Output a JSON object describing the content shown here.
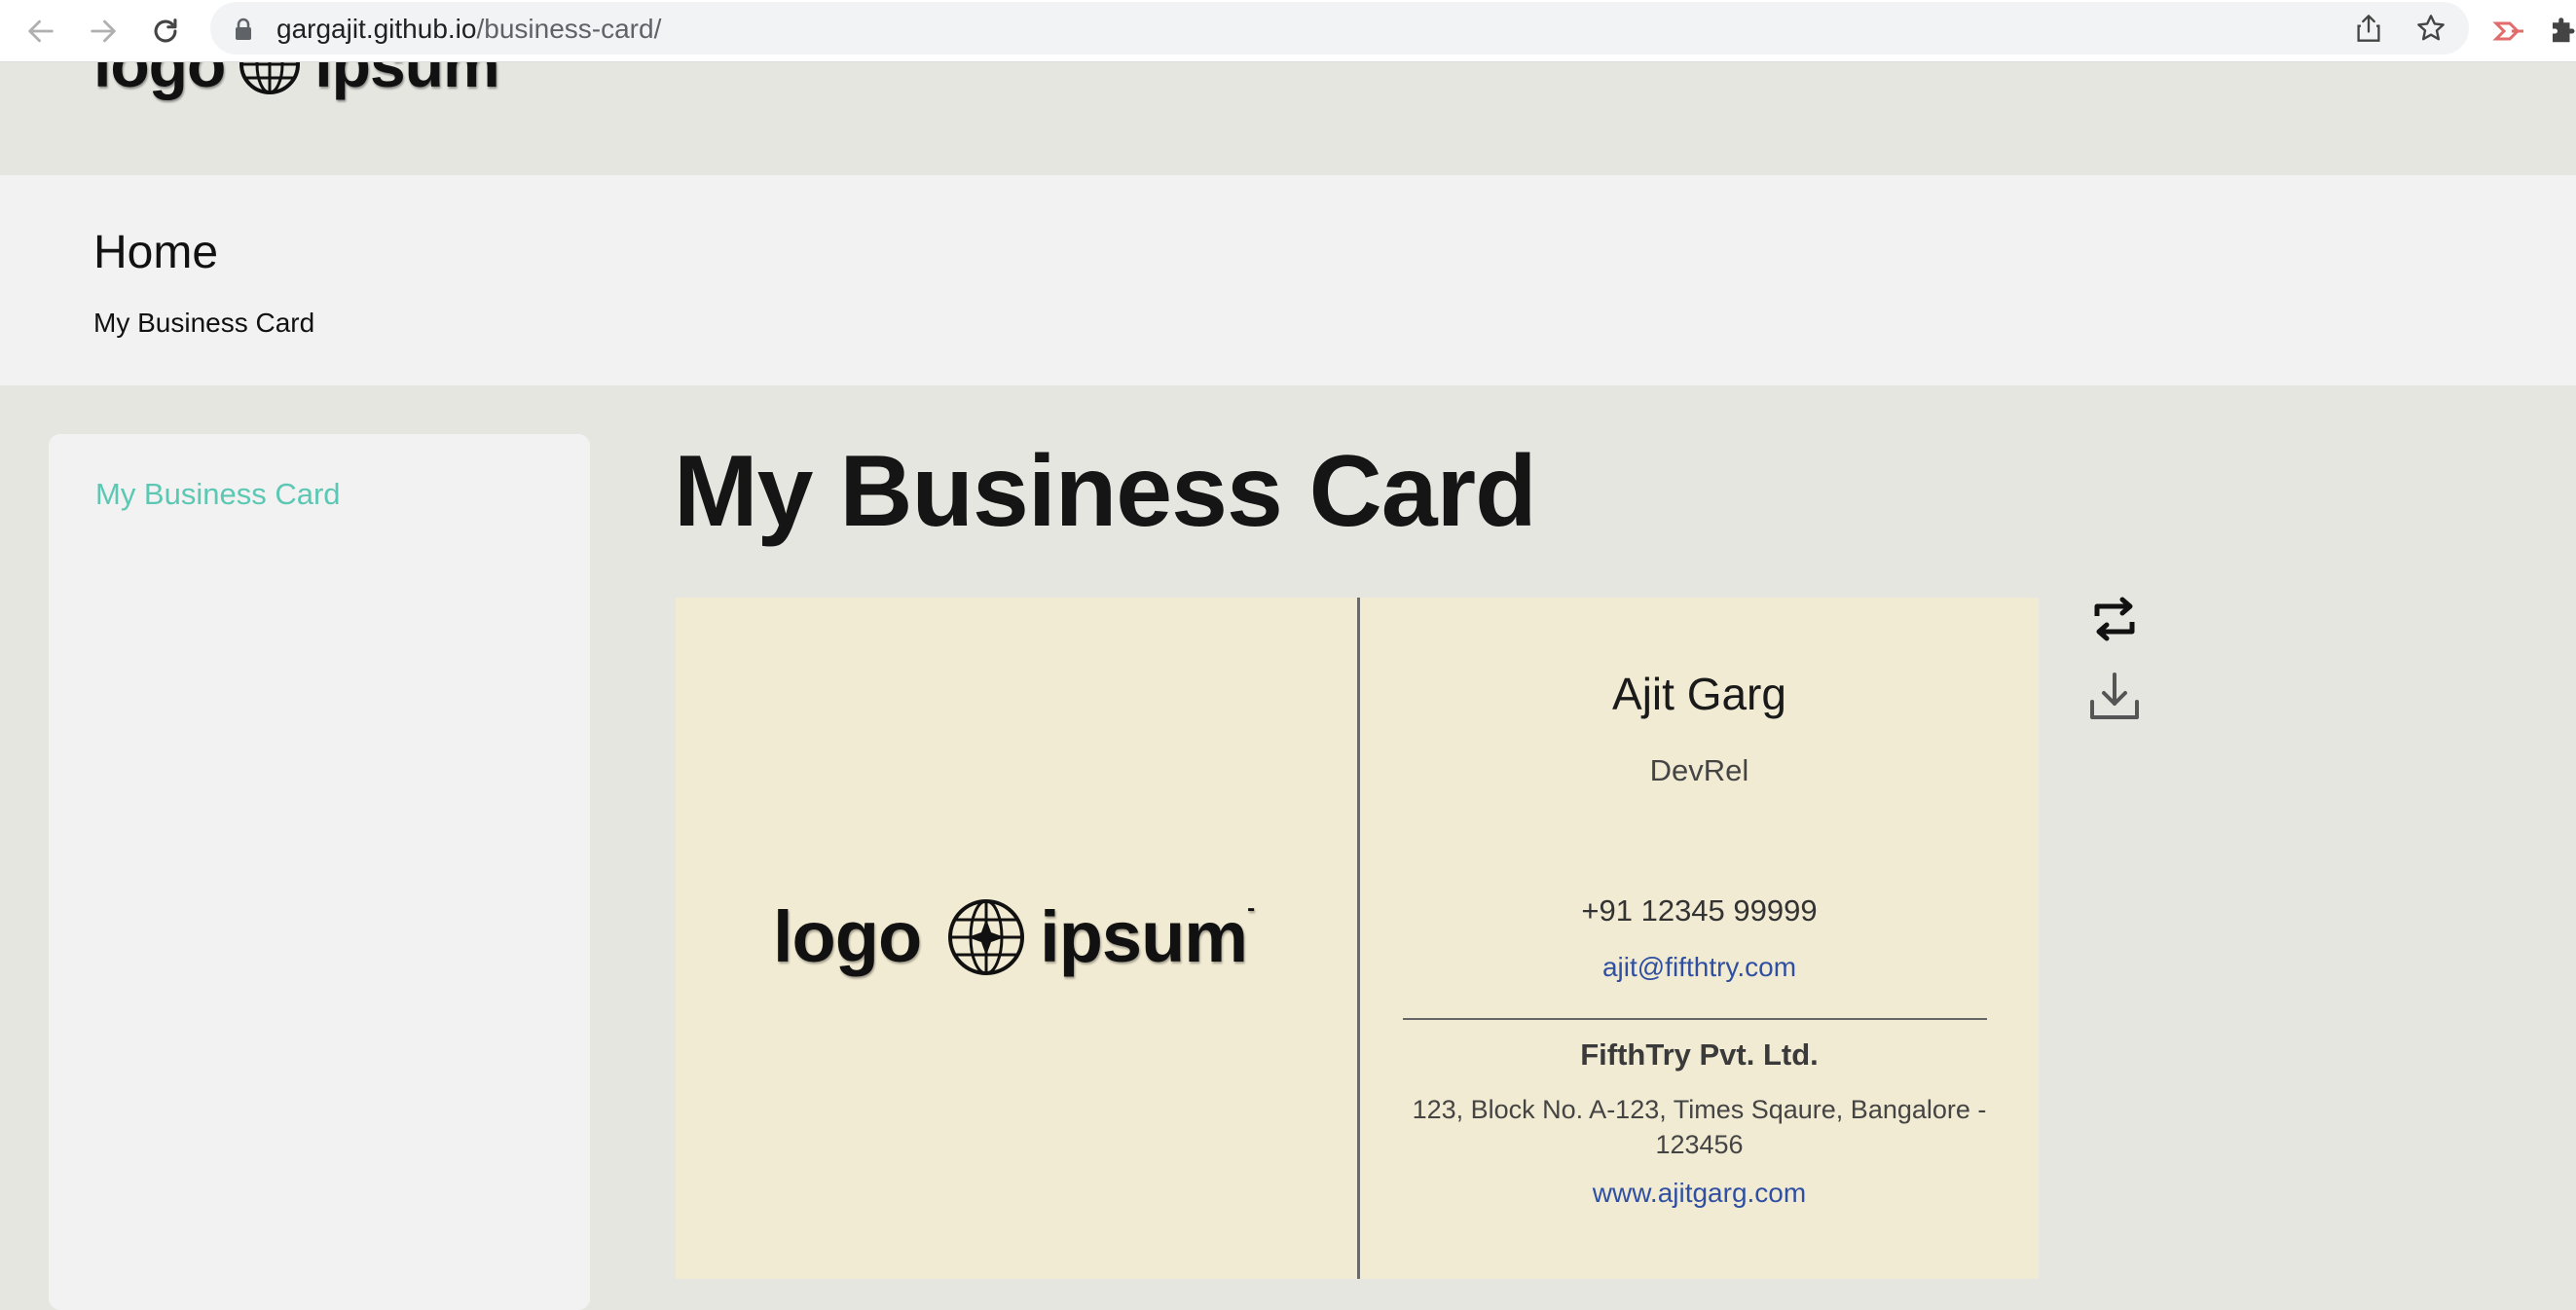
{
  "browser": {
    "url_host": "gargajit.github.io",
    "url_path": "/business-card/"
  },
  "header": {
    "logo_word_left": "logo",
    "logo_word_right": "ipsum"
  },
  "breadcrumb": {
    "title": "Home",
    "current": "My Business Card"
  },
  "sidebar": {
    "items": [
      {
        "label": "My Business Card"
      }
    ]
  },
  "main": {
    "title": "My Business Card"
  },
  "card": {
    "logo_word_left": "logo",
    "logo_word_right": "ipsum",
    "name": "Ajit Garg",
    "role": "DevRel",
    "phone": "+91 12345 99999",
    "email": "ajit@fifthtry.com",
    "company": "FifthTry Pvt. Ltd.",
    "address": "123, Block No. A-123, Times Sqaure, Bangalore - 123456",
    "website": "www.ajitgarg.com"
  },
  "colors": {
    "accent": "#5cc8b4",
    "card_bg": "#f2ebd3",
    "link": "#2f4fa2",
    "page_bg": "#e6e6e1"
  },
  "icons": [
    "back-icon",
    "forward-icon",
    "reload-icon",
    "lock-icon",
    "share-icon",
    "bookmark-star-icon",
    "extension-icon",
    "puzzle-icon",
    "globe-icon",
    "flip-icon",
    "download-icon"
  ]
}
